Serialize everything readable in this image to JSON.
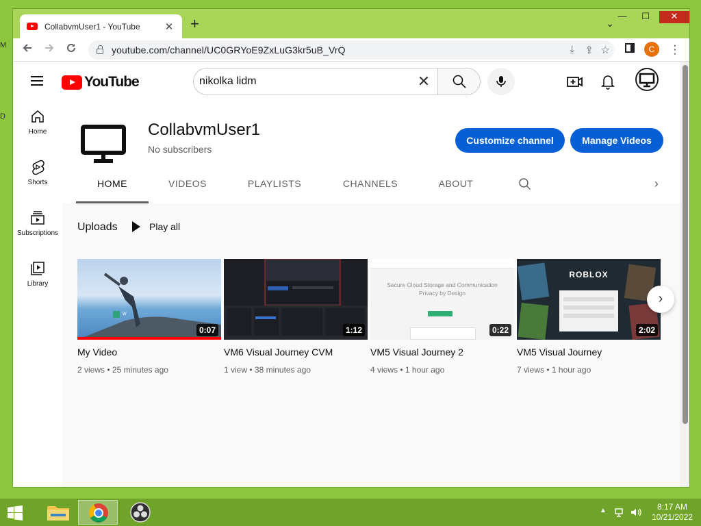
{
  "browser": {
    "tab_title": "CollabvmUser1 - YouTube",
    "url": "youtube.com/channel/UC0GRYoE9ZxLuG3kr5uB_VrQ",
    "profile_initial": "C"
  },
  "youtube": {
    "search_query": "nikolka lidm",
    "logo_text": "YouTube",
    "sidebar": [
      {
        "label": "Home"
      },
      {
        "label": "Shorts"
      },
      {
        "label": "Subscriptions"
      },
      {
        "label": "Library"
      }
    ],
    "channel": {
      "name": "CollabvmUser1",
      "subscribers": "No subscribers",
      "customize_label": "Customize channel",
      "manage_label": "Manage Videos"
    },
    "tabs": [
      "HOME",
      "VIDEOS",
      "PLAYLISTS",
      "CHANNELS",
      "ABOUT"
    ],
    "active_tab": "HOME",
    "uploads": {
      "title": "Uploads",
      "play_all": "Play all"
    },
    "videos": [
      {
        "title": "My Video",
        "duration": "0:07",
        "views": "2 views",
        "age": "25 minutes ago",
        "watched_fraction": 1.0
      },
      {
        "title": "VM6 Visual Journey CVM",
        "duration": "1:12",
        "views": "1 view",
        "age": "38 minutes ago"
      },
      {
        "title": "VM5 Visual Journey 2",
        "duration": "0:22",
        "views": "4 views",
        "age": "1 hour ago"
      },
      {
        "title": "VM5 Visual Journey",
        "duration": "2:02",
        "views": "7 views",
        "age": "1 hour ago"
      }
    ],
    "thumb_text": {
      "v3_line1": "Secure Cloud Storage and Communication",
      "v3_line2": "Privacy by Design",
      "v4_logo": "ROBLOX"
    }
  },
  "taskbar": {
    "time": "8:17 AM",
    "date": "10/21/2022"
  },
  "colors": {
    "desktop": "#8cc63f",
    "accent_blue": "#065fd4",
    "yt_red": "#ff0000",
    "taskbar": "#6fa32a"
  }
}
